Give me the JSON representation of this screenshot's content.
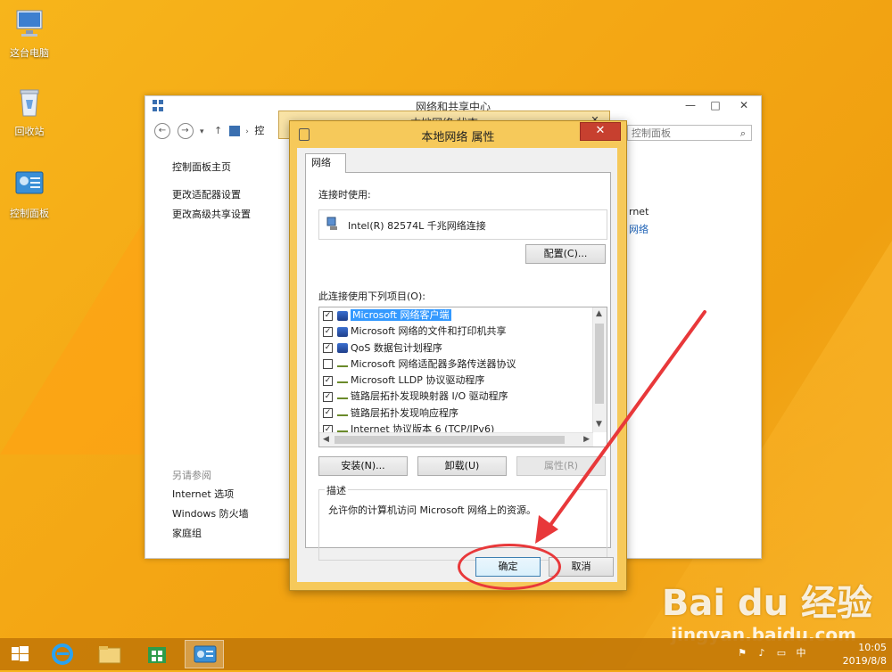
{
  "desktop": {
    "icons": [
      {
        "label": "这台电脑"
      },
      {
        "label": "回收站"
      },
      {
        "label": "控制面板"
      }
    ]
  },
  "bg_window": {
    "title": "网络和共享中心",
    "address_partial": "控",
    "search_placeholder": "控制面板",
    "sidebar_links": [
      "控制面板主页",
      "更改适配器设置",
      "更改高级共享设置"
    ],
    "see_also_heading": "另请参阅",
    "see_also_links": [
      "Internet 选项",
      "Windows 防火墙",
      "家庭组"
    ],
    "right_partial_1": "rnet",
    "right_partial_2": "网络"
  },
  "status_window": {
    "title_partial": "本地网络 状态"
  },
  "dialog": {
    "title": "本地网络 属性",
    "close_label": "✕",
    "tab_label": "网络",
    "connect_using_label": "连接时使用:",
    "adapter_name": "Intel(R) 82574L 千兆网络连接",
    "configure_button": "配置(C)...",
    "items_label": "此连接使用下列项目(O):",
    "items": [
      {
        "label": "Microsoft 网络客户端",
        "checked": true,
        "selected": true
      },
      {
        "label": "Microsoft 网络的文件和打印机共享",
        "checked": true
      },
      {
        "label": "QoS 数据包计划程序",
        "checked": true
      },
      {
        "label": "Microsoft 网络适配器多路传送器协议",
        "checked": false
      },
      {
        "label": "Microsoft LLDP 协议驱动程序",
        "checked": true
      },
      {
        "label": "链路层拓扑发现映射器 I/O 驱动程序",
        "checked": true
      },
      {
        "label": "链路层拓扑发现响应程序",
        "checked": true
      },
      {
        "label": "Internet 协议版本 6 (TCP/IPv6)",
        "checked": true
      }
    ],
    "install_button": "安装(N)...",
    "uninstall_button": "卸载(U)",
    "properties_button": "属性(R)",
    "description_legend": "描述",
    "description_text": "允许你的计算机访问 Microsoft 网络上的资源。",
    "ok_button": "确定",
    "cancel_button": "取消"
  },
  "watermark": {
    "logo": "Bai du 经验",
    "url": "jingyan.baidu.com"
  },
  "taskbar": {
    "time": "10:05",
    "date": "2019/8/8"
  },
  "colors": {
    "desktop": "#f4a614",
    "dialog_frame": "#f6c95a",
    "close_button": "#c7402f",
    "annotation": "#e8383a",
    "selection": "#3399ff"
  }
}
